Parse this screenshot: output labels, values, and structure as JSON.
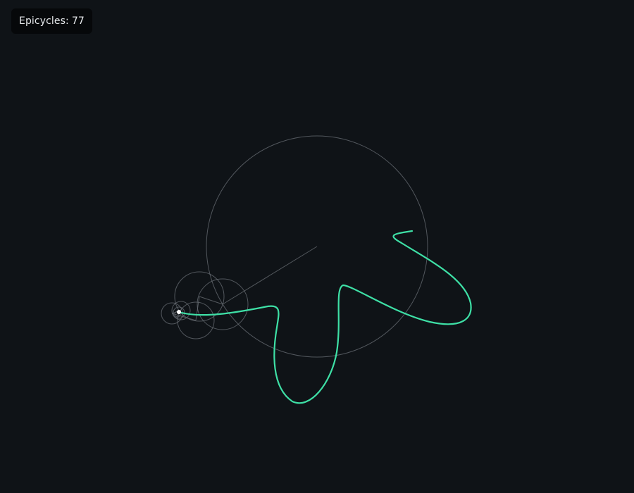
{
  "hud": {
    "label": "Epicycles:",
    "count": "77"
  },
  "colors": {
    "background": "#0f1317",
    "trace": "#3ee0a6",
    "circle": "#6a6f75",
    "pen": "#ffffff",
    "hud_bg": "#06080a",
    "hud_text": "#e6e9ec"
  }
}
